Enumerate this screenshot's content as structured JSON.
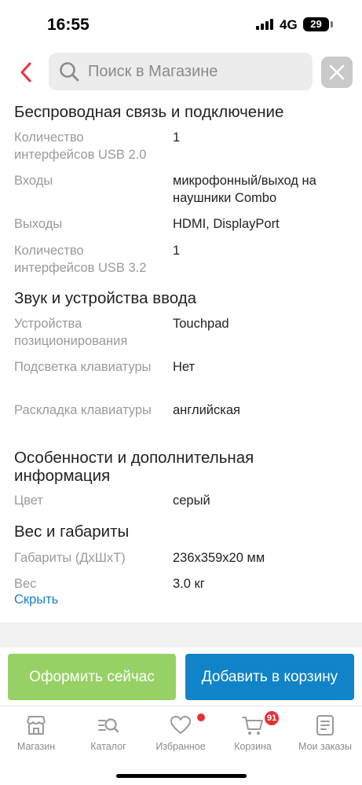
{
  "status_bar": {
    "time": "16:55",
    "network": "4G",
    "battery": "29"
  },
  "search": {
    "placeholder": "Поиск в Магазине"
  },
  "sections": [
    {
      "title": "Беспроводная связь и подключение",
      "rows": [
        {
          "label": "Количество интерфейсов USB 2.0",
          "value": "1"
        },
        {
          "label": "Входы",
          "value": "микрофонный/выход на наушники Combo"
        },
        {
          "label": "Выходы",
          "value": "HDMI, DisplayPort"
        },
        {
          "label": "Количество интерфейсов USB 3.2",
          "value": "1"
        }
      ]
    },
    {
      "title": "Звук и устройства ввода",
      "rows": [
        {
          "label": "Устройства позиционирования",
          "value": "Touchpad"
        },
        {
          "label": "Подсветка клавиатуры",
          "value": "Нет"
        },
        {
          "label": "Раскладка клавиатуры",
          "value": "английская"
        }
      ]
    },
    {
      "title": "Особенности и дополнительная информация",
      "rows": [
        {
          "label": "Цвет",
          "value": "серый"
        }
      ]
    },
    {
      "title": "Вес и габариты",
      "rows": [
        {
          "label": "Габариты (ДхШхТ)",
          "value": "236x359x20 мм"
        },
        {
          "label": "Вес",
          "value": "3.0 кг"
        }
      ]
    }
  ],
  "hide_link": "Скрыть",
  "actions": {
    "checkout": "Оформить сейчас",
    "add_to_cart": "Добавить в корзину"
  },
  "nav": [
    {
      "label": "Магазин",
      "icon": "store-icon"
    },
    {
      "label": "Каталог",
      "icon": "catalog-search-icon"
    },
    {
      "label": "Избранное",
      "icon": "heart-icon"
    },
    {
      "label": "Корзина",
      "icon": "cart-icon",
      "badge": "91"
    },
    {
      "label": "Мои заказы",
      "icon": "orders-icon"
    }
  ],
  "colors": {
    "accent_red": "#e8303a",
    "checkout_green": "#97d165",
    "cart_blue": "#1083c9",
    "link_blue": "#1a7fd0"
  }
}
